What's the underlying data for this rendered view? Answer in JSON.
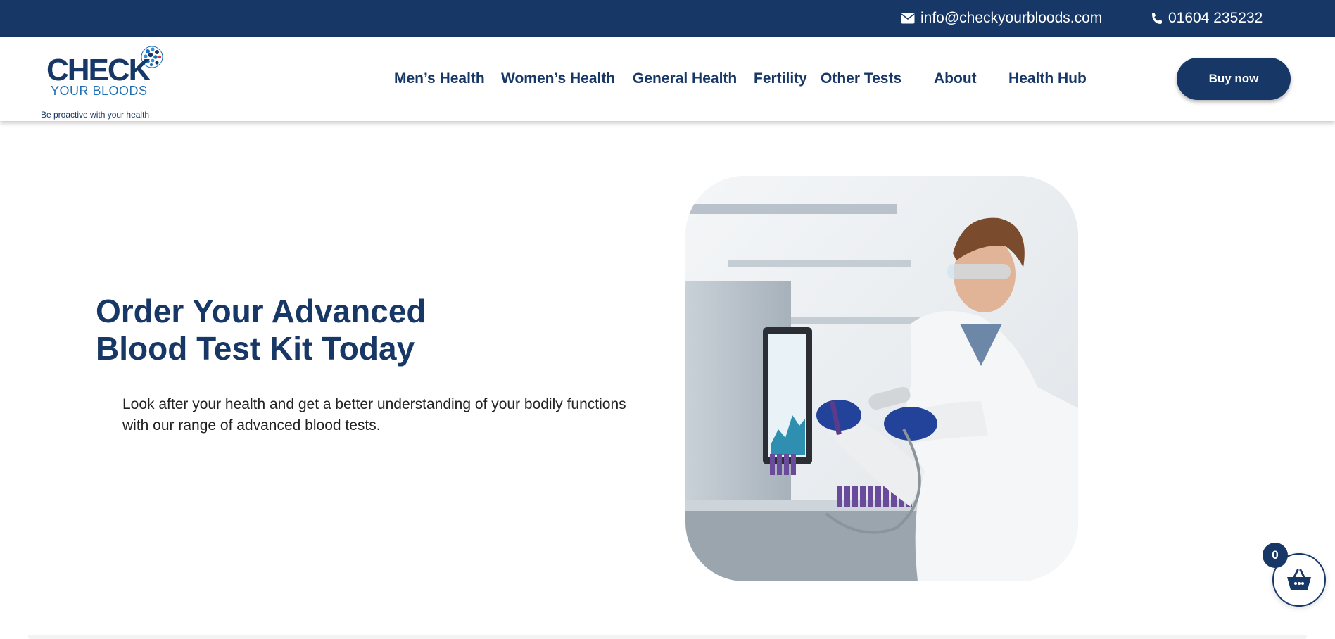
{
  "topbar": {
    "email": "info@checkyourbloods.com",
    "phone": "01604 235232",
    "email_icon": "envelope-icon",
    "phone_icon": "phone-icon"
  },
  "logo": {
    "brand": "CHECK",
    "brand_sub": "YOUR BLOODS",
    "tagline": "Be proactive with your health"
  },
  "nav": {
    "items": [
      {
        "label": "Men’s Health"
      },
      {
        "label": "Women’s Health"
      },
      {
        "label": "General Health"
      },
      {
        "label": "Fertility"
      },
      {
        "label": "Other Tests"
      },
      {
        "label": "About"
      },
      {
        "label": "Health Hub"
      }
    ]
  },
  "header": {
    "buy_label": "Buy now"
  },
  "hero": {
    "title_line1": "Order Your Advanced",
    "title_line2": "Blood Test Kit Today",
    "text": "Look after your health and get a better understanding of your bodily functions with our range of advanced blood tests.",
    "image_alt": "Lab technician scanning a blood sample tube"
  },
  "cart": {
    "count": "0",
    "icon": "basket-icon"
  },
  "colors": {
    "navy": "#173766",
    "accent_blue": "#1f6fb6",
    "text_dark": "#222222",
    "white": "#ffffff"
  }
}
